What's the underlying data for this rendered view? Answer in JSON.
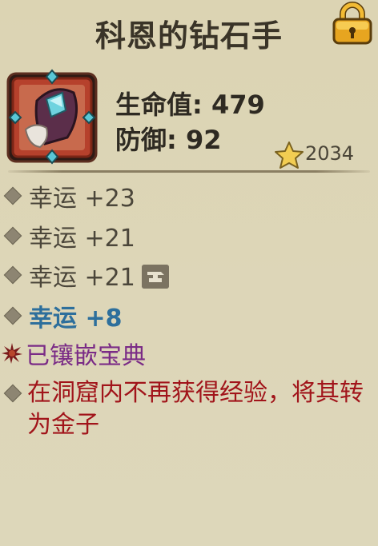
{
  "title": "科恩的钻石手",
  "stats": {
    "hp_label": "生命值: 479",
    "def_label": "防御: 92"
  },
  "rating": "2034",
  "icons": {
    "lock": "lock-icon",
    "item": "diamond-gauntlet-icon",
    "star": "star-icon",
    "anvil": "anvil-icon",
    "burst": "burst-icon"
  },
  "affixes": [
    {
      "text": "幸运 +23"
    },
    {
      "text": "幸运 +21"
    },
    {
      "text": "幸运 +21"
    },
    {
      "text": "幸运 +8"
    }
  ],
  "socket": "已镶嵌宝典",
  "description": "在洞窟内不再获得经验，将其转为金子",
  "colors": {
    "background": "#ddd6b6",
    "affix_enhanced": "#2d6f9c",
    "socket": "#7a2b86",
    "description": "#a1141a",
    "lock": "#e7a520"
  }
}
